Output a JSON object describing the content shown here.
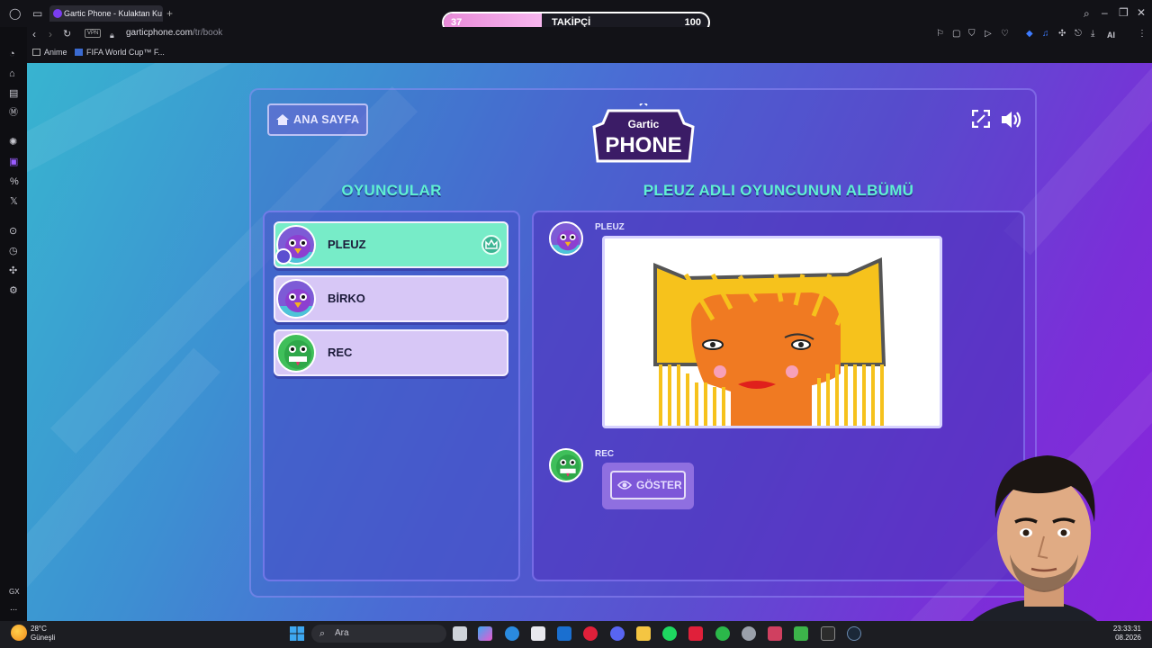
{
  "browser": {
    "tab_title": "Gartic Phone - Kulaktan Ku",
    "url_host": "garticphone.com",
    "url_path": "/tr/book",
    "vpn_label": "VPN",
    "ai_label": "AI",
    "bookmarks": [
      "Anime",
      "FIFA World Cup™ F..."
    ]
  },
  "overlay": {
    "follower_label": "TAKİPÇİ",
    "current": "37",
    "goal": "100",
    "progress": 0.37
  },
  "game": {
    "home_button": "ANA SAYFA",
    "logo_top": "Gartic",
    "logo_main": "PHONE",
    "players_heading": "OYUNCULAR",
    "album_heading": "PLEUZ ADLI OYUNCUNUN ALBÜMÜ",
    "players": [
      {
        "name": "PLEUZ",
        "host": true
      },
      {
        "name": "BİRKO",
        "host": false
      },
      {
        "name": "REC",
        "host": false
      }
    ],
    "album": {
      "entries": [
        {
          "author": "PLEUZ"
        },
        {
          "author": "REC",
          "reveal_button": "GÖSTER"
        }
      ]
    }
  },
  "taskbar": {
    "temperature": "28°C",
    "weather": "Güneşli",
    "search_placeholder": "Ara",
    "time": "23:33:31",
    "date": "08.2026"
  },
  "sidebar_labels": {
    "gx": "GX",
    "more": "..."
  }
}
